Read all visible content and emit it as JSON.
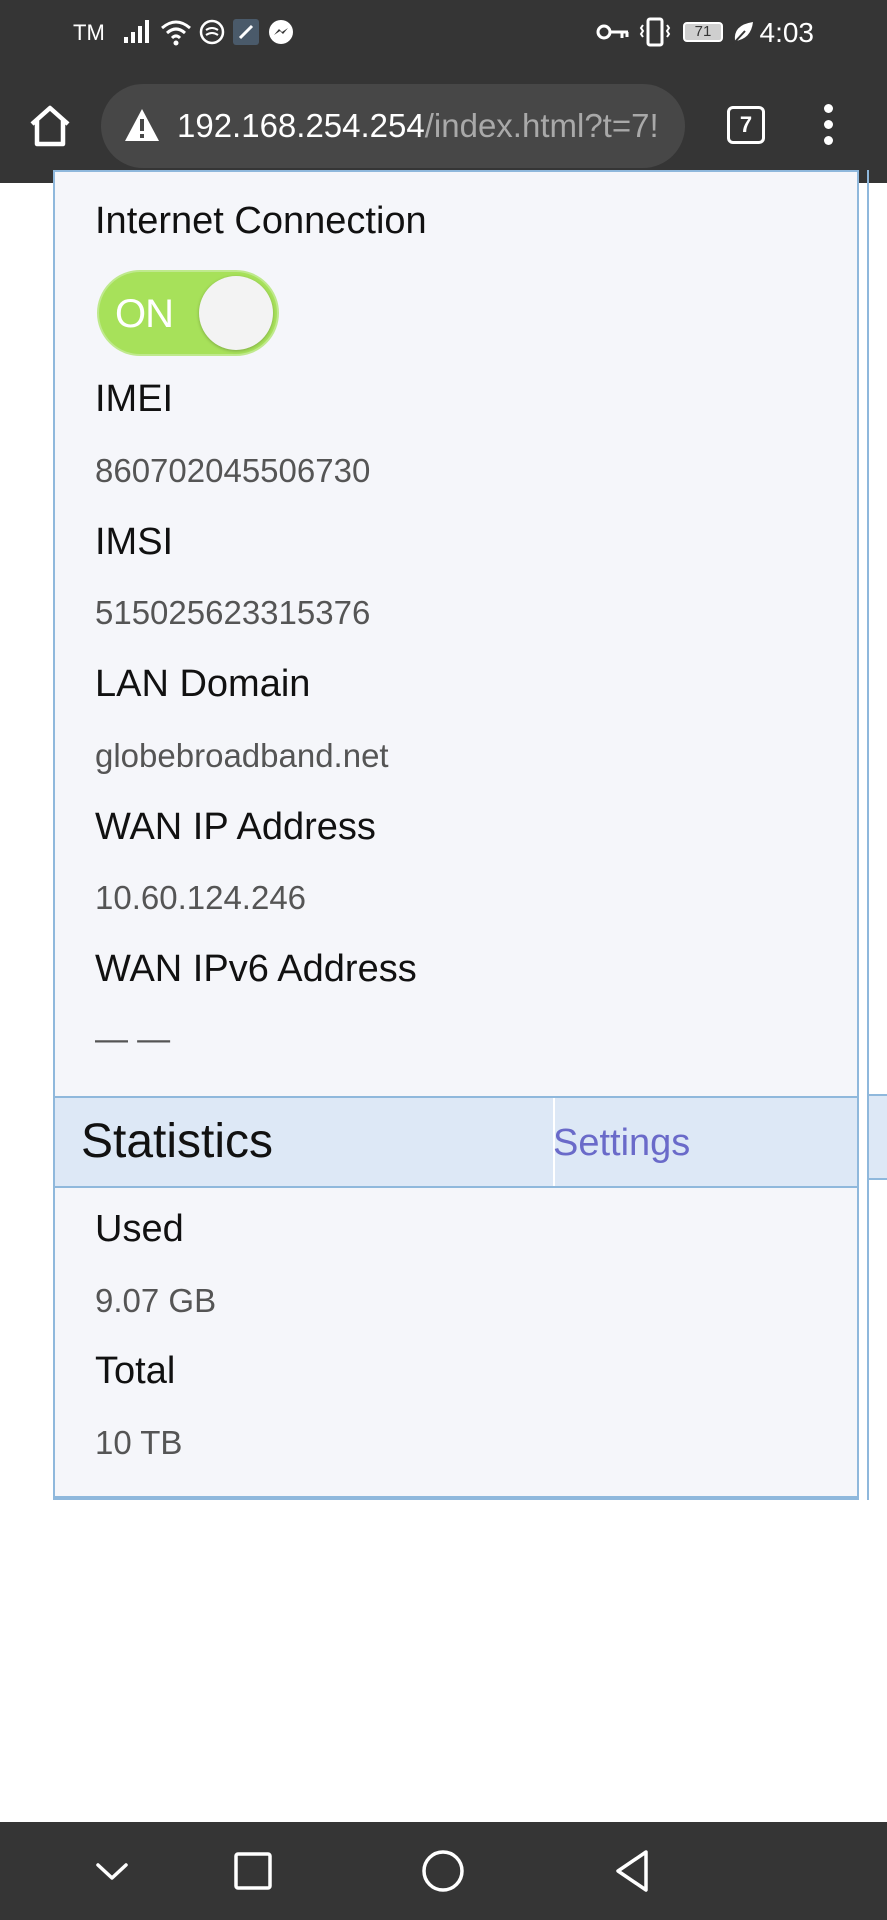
{
  "status_bar": {
    "carrier": "TM",
    "time": "4:03",
    "battery": "71",
    "icons": [
      "signal-icon",
      "wifi-icon",
      "data-saver-icon",
      "app-icon",
      "messenger-icon",
      "vpn-key-icon",
      "vibrate-icon",
      "battery-icon",
      "eco-leaf-icon"
    ]
  },
  "browser": {
    "url_host": "192.168.254.254",
    "url_path": "/index.html?t=7!",
    "tab_count": "7",
    "icons": [
      "home-icon",
      "warning-icon",
      "tabs-icon",
      "more-menu-icon"
    ]
  },
  "device_info": {
    "internet_connection_label": "Internet Connection",
    "internet_toggle_state": "ON",
    "imei_label": "IMEI",
    "imei_value": "860702045506730",
    "imsi_label": "IMSI",
    "imsi_value": "515025623315376",
    "lan_domain_label": "LAN Domain",
    "lan_domain_value": "globebroadband.net",
    "wan_ip_label": "WAN IP Address",
    "wan_ip_value": "10.60.124.246",
    "wan_ipv6_label": "WAN IPv6 Address",
    "wan_ipv6_value": "— —"
  },
  "statistics": {
    "title": "Statistics",
    "settings_link": "Settings",
    "used_label": "Used",
    "used_value": "9.07 GB",
    "total_label": "Total",
    "total_value": "10 TB"
  },
  "nav_bar": {
    "icons": [
      "collapse-icon",
      "recents-icon",
      "home-circle-icon",
      "back-icon"
    ]
  },
  "colors": {
    "toggle_on": "#a7e15a",
    "panel_border": "#8fb8dc",
    "header_bg": "#dde8f6",
    "link": "#6a6ac9",
    "chrome_bg": "#353535"
  }
}
